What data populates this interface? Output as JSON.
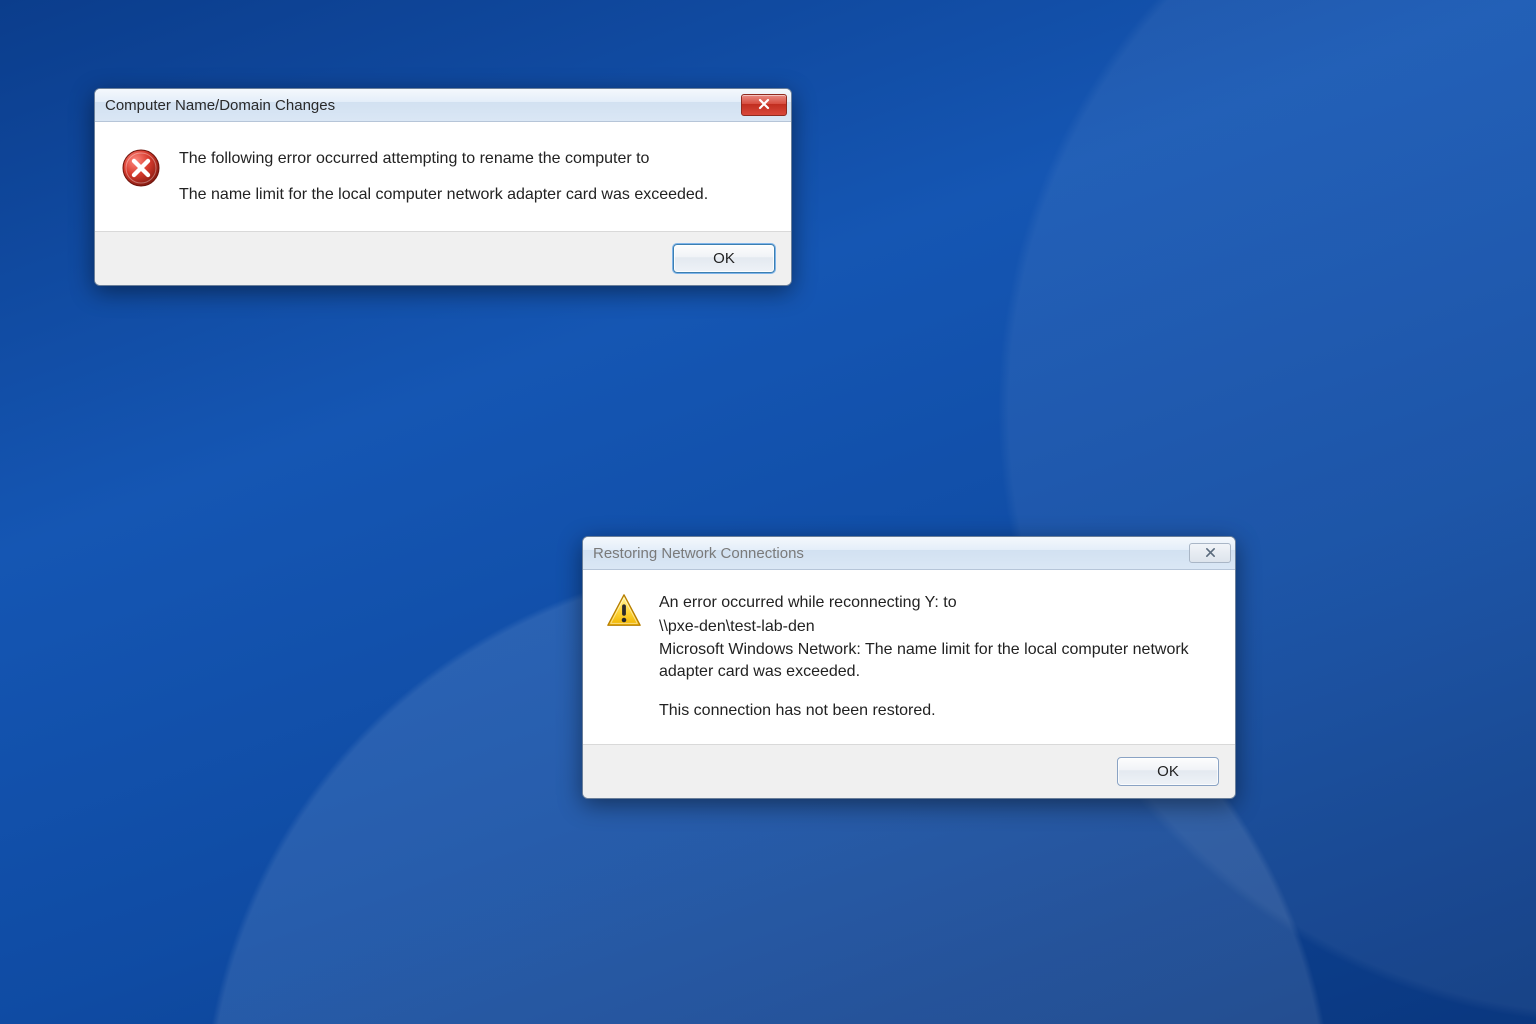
{
  "dialogs": {
    "d1": {
      "title": "Computer Name/Domain Changes",
      "msg_line1": "The following error occurred attempting to rename the computer to",
      "msg_line2": "The name limit for the local computer network adapter card was exceeded.",
      "ok_label": "OK"
    },
    "d2": {
      "title": "Restoring Network Connections",
      "msg_line1": "An error occurred while reconnecting Y: to",
      "msg_path": "\\\\pxe-den\\test-lab-den",
      "msg_line2": "Microsoft Windows Network: The name limit for the local computer network adapter card was exceeded.",
      "msg_line3": "This connection has not been restored.",
      "ok_label": "OK"
    }
  }
}
